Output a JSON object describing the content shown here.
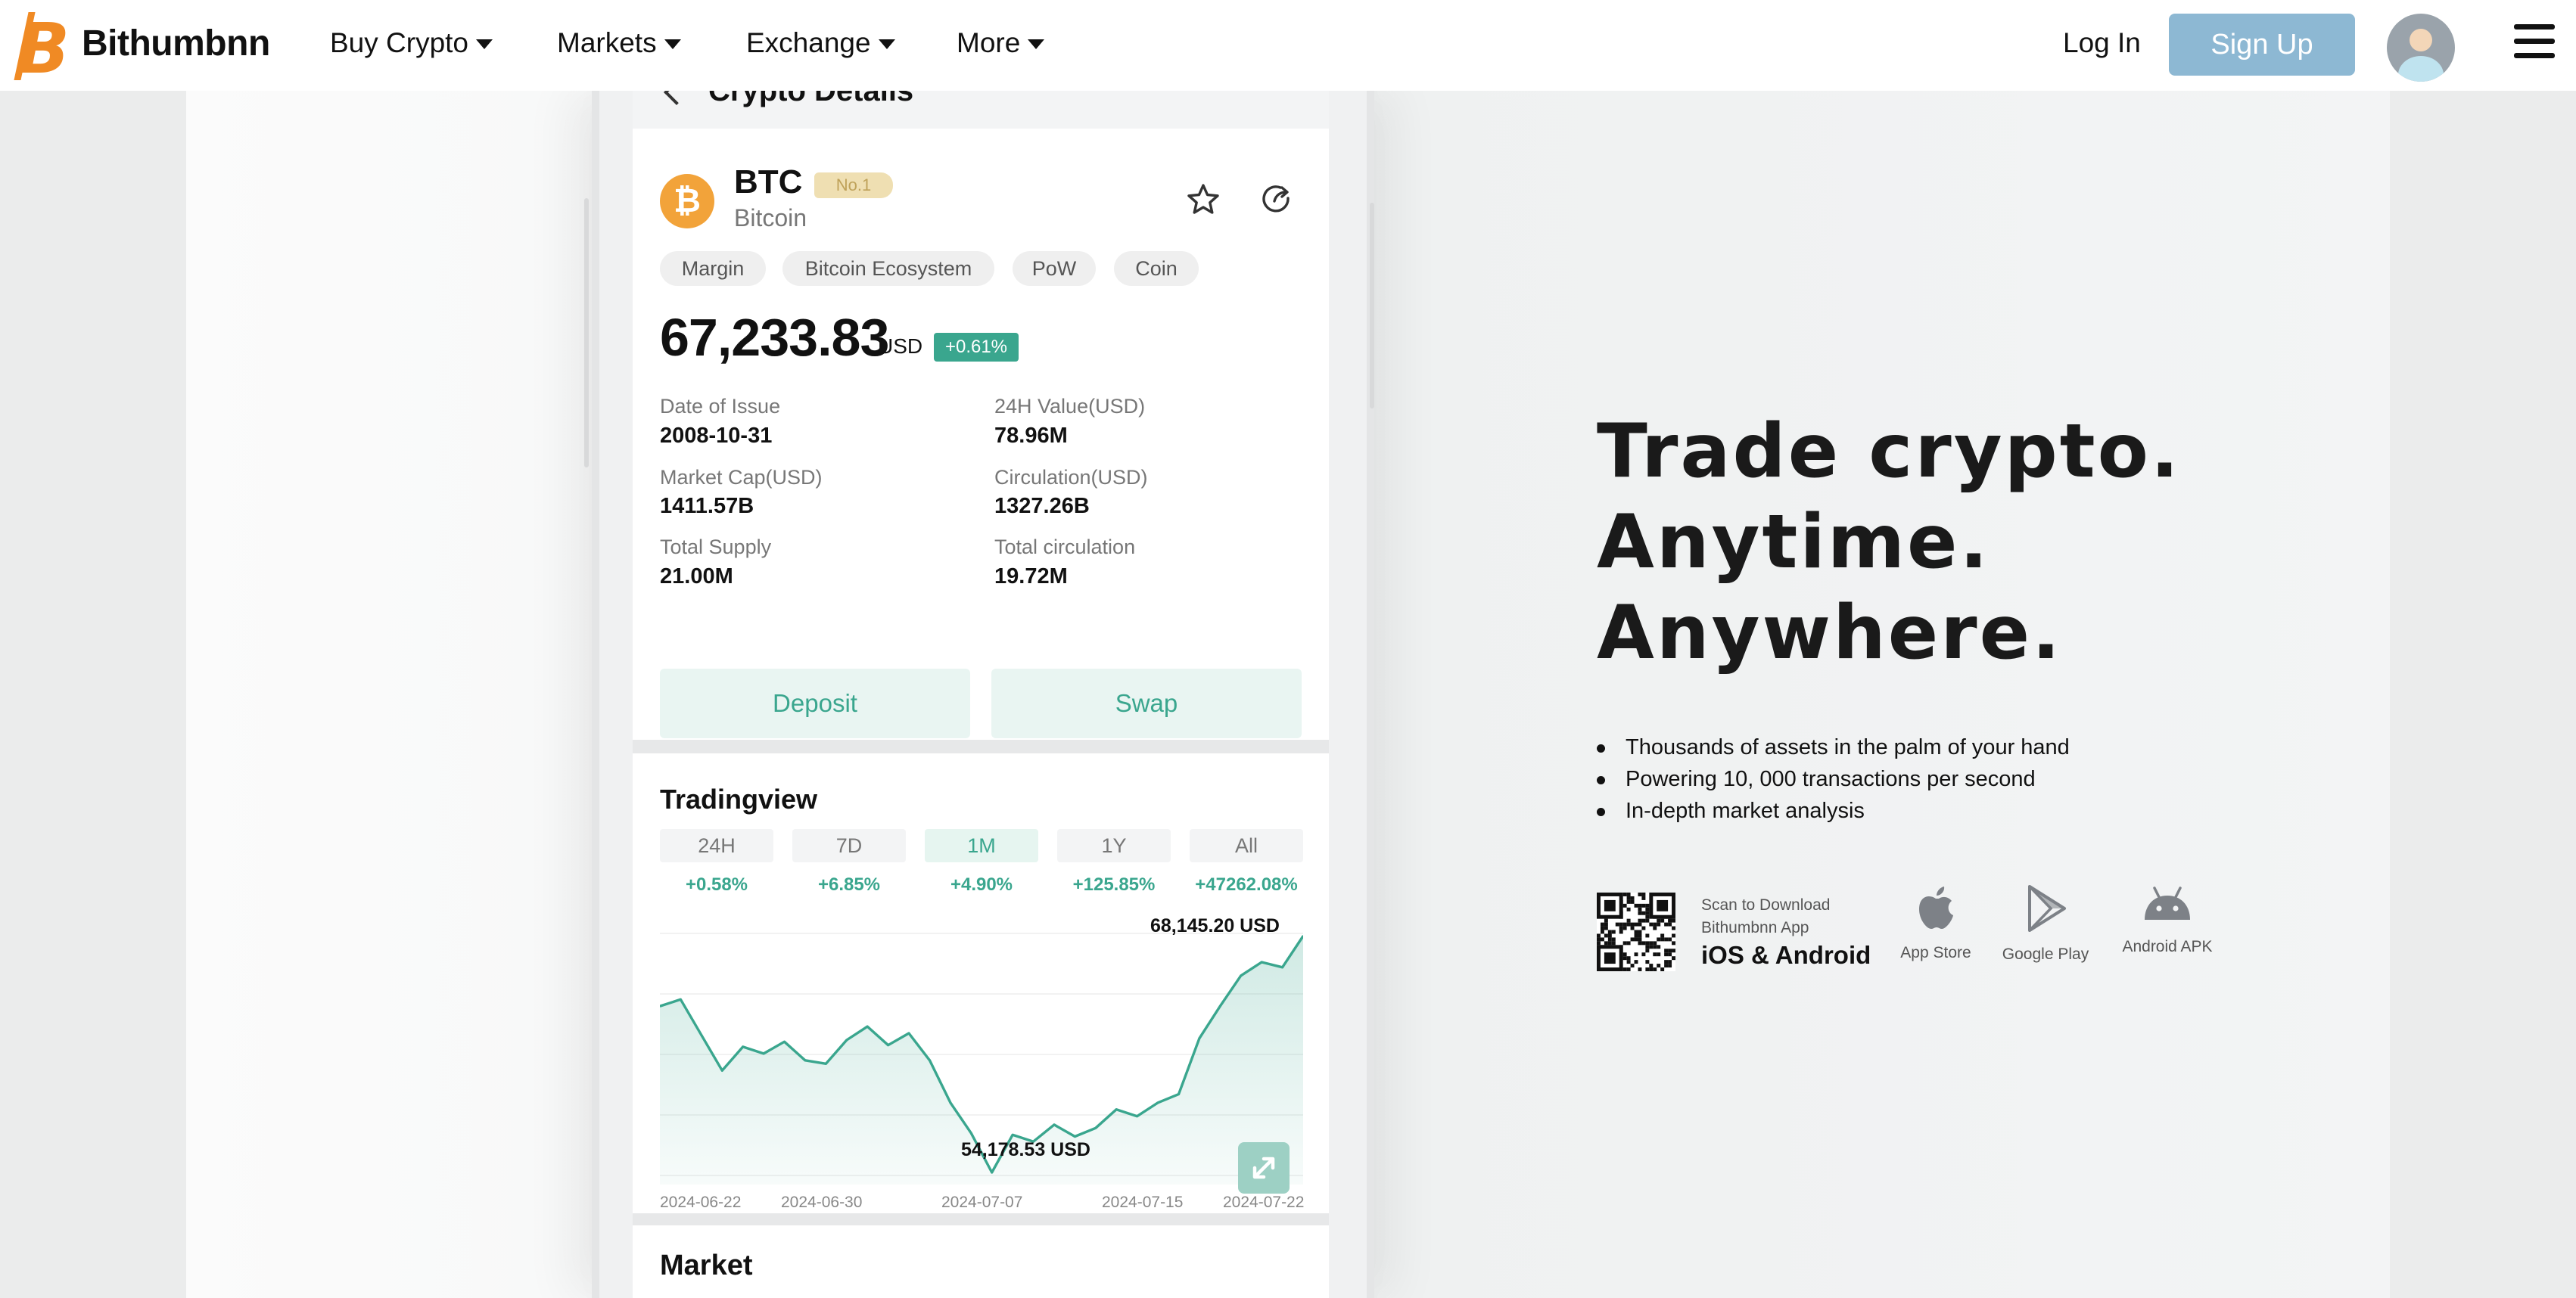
{
  "nav": {
    "brand": "Bithumbnn",
    "items": [
      {
        "label": "Buy Crypto"
      },
      {
        "label": "Markets"
      },
      {
        "label": "Exchange"
      },
      {
        "label": "More"
      }
    ],
    "login": "Log In",
    "signup": "Sign Up",
    "colors": {
      "signup_bg": "#8db8d3",
      "logo_orange": "#f08a24"
    }
  },
  "detail": {
    "header_title": "Crypto Details",
    "coin": {
      "symbol": "BTC",
      "rank": "No.1",
      "name": "Bitcoin",
      "icon": "bitcoin-icon",
      "icon_glyph": "₿"
    },
    "tags": [
      "Margin",
      "Bitcoin Ecosystem",
      "PoW",
      "Coin"
    ],
    "price": "67,233.83",
    "price_unit": "USD",
    "change": "+0.61%",
    "stats": [
      {
        "label": "Date of Issue",
        "value": "2008-10-31"
      },
      {
        "label": "24H Value(USD)",
        "value": "78.96M"
      },
      {
        "label": "Market Cap(USD)",
        "value": "1411.57B"
      },
      {
        "label": "Circulation(USD)",
        "value": "1327.26B"
      },
      {
        "label": "Total Supply",
        "value": "21.00M"
      },
      {
        "label": "Total circulation",
        "value": "19.72M"
      }
    ],
    "actions": [
      "Deposit",
      "Swap"
    ],
    "accent_color": "#3aa68e"
  },
  "tradingview": {
    "title": "Tradingview",
    "ranges": [
      {
        "label": "24H",
        "change": "+0.58%"
      },
      {
        "label": "7D",
        "change": "+6.85%"
      },
      {
        "label": "1M",
        "change": "+4.90%"
      },
      {
        "label": "1Y",
        "change": "+125.85%"
      },
      {
        "label": "All",
        "change": "+47262.08%"
      }
    ],
    "active_range": "1M"
  },
  "chart_data": {
    "type": "area",
    "title": "",
    "high_label": "68,145.20  USD",
    "low_label": "54,178.53  USD",
    "x_ticks": [
      "2024-06-22",
      "2024-06-30",
      "2024-07-07",
      "2024-07-15",
      "2024-07-22"
    ],
    "x_range": [
      "2024-06-22",
      "2024-07-23"
    ],
    "ylim": [
      54000,
      68300
    ],
    "series": [
      {
        "color": "#3aa68e",
        "points": [
          [
            "2024-06-22",
            64000
          ],
          [
            "2024-06-23",
            64400
          ],
          [
            "2024-06-24",
            62300
          ],
          [
            "2024-06-25",
            60200
          ],
          [
            "2024-06-26",
            61600
          ],
          [
            "2024-06-27",
            61200
          ],
          [
            "2024-06-28",
            61900
          ],
          [
            "2024-06-29",
            60800
          ],
          [
            "2024-06-30",
            60600
          ],
          [
            "2024-07-01",
            62000
          ],
          [
            "2024-07-02",
            62800
          ],
          [
            "2024-07-03",
            61700
          ],
          [
            "2024-07-04",
            62400
          ],
          [
            "2024-07-05",
            60800
          ],
          [
            "2024-07-06",
            58300
          ],
          [
            "2024-07-07",
            56500
          ],
          [
            "2024-07-08",
            54178
          ],
          [
            "2024-07-09",
            56400
          ],
          [
            "2024-07-10",
            56000
          ],
          [
            "2024-07-11",
            57000
          ],
          [
            "2024-07-12",
            56300
          ],
          [
            "2024-07-13",
            56800
          ],
          [
            "2024-07-14",
            57900
          ],
          [
            "2024-07-15",
            57500
          ],
          [
            "2024-07-16",
            58300
          ],
          [
            "2024-07-17",
            58800
          ],
          [
            "2024-07-18",
            62100
          ],
          [
            "2024-07-19",
            64000
          ],
          [
            "2024-07-20",
            65800
          ],
          [
            "2024-07-21",
            66600
          ],
          [
            "2024-07-22",
            66300
          ],
          [
            "2024-07-23",
            68145
          ]
        ]
      }
    ],
    "grid": true
  },
  "market": {
    "title": "Market"
  },
  "hero": {
    "lines": [
      "Trade crypto.",
      "Anytime.",
      "Anywhere."
    ],
    "bullets": [
      "Thousands of assets in the palm of your hand",
      "Powering 10, 000 transactions per second",
      "In-depth market analysis"
    ],
    "scan_label": "Scan to Download Bithumbnn App",
    "platforms": "iOS & Android",
    "stores": [
      {
        "label": "App Store",
        "icon": "apple-icon"
      },
      {
        "label": "Google Play",
        "icon": "google-play-icon"
      },
      {
        "label": "Android APK",
        "icon": "android-icon"
      }
    ]
  }
}
